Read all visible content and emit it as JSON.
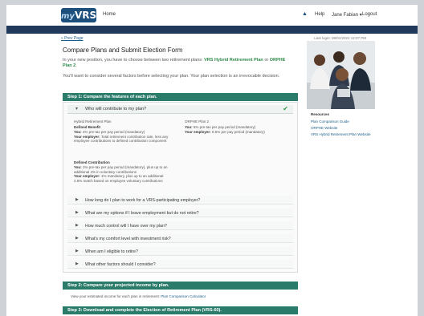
{
  "header": {
    "logo_my": "my",
    "logo_vrs": "VRS",
    "home_link": "Home",
    "help_link": "Help",
    "user_menu": "Jane Fabian ▾",
    "logout_link": "Logout"
  },
  "breadcrumb": {
    "back_link": "« Prev Page",
    "last_login": "Last login: 06/01/2021 12:07 PM"
  },
  "page": {
    "title": "Compare Plans and Submit Election Form",
    "intro_prefix": "In your new position, you have to choose between two retirement plans:",
    "intro_plan1": "VRS Hybrid Retirement Plan",
    "intro_or": "or",
    "intro_plan2": "ORPHE Plan 2",
    "intro_suffix": ".",
    "intro2": "You'll want to consider several factors before selecting your plan. Your plan selection is an irrevocable decision."
  },
  "step1": {
    "label": "Step 1: Compare the features of each plan.",
    "open_question": "Who will contribute to my plan?",
    "col1_head": "Hybrid Retirement Plan",
    "col1_sub1": "Defined Benefit",
    "col1_text1_you": "You:",
    "col1_text1": " 4% pre-tax per pay period (mandatory)",
    "col1_text1_emp": "Your employer:",
    "col1_text1b": " Total retirement contribution rate, less any employee contributions to defined contribution component",
    "col1_sub2": "Defined Contribution",
    "col1_text2_you": "You:",
    "col1_text2": " 1% pre-tax per pay period (mandatory), plus up to an additional 4% in voluntary contributions",
    "col1_text2_emp": "Your employer:",
    "col1_text2b": " 1% mandatory, plus up to an additional 2.5% match based on employee voluntary contributions",
    "col2_head": "ORPHE Plan 2",
    "col2_text_you": "You:",
    "col2_text": " 5% pre-tax per pay period (mandatory)",
    "col2_text_emp": "Your employer:",
    "col2_textb": " 8.5% per pay period (mandatory)",
    "questions": [
      "How long do I plan to work for a VRS-participating employer?",
      "What are my options if I leave employment but do not retire?",
      "How much control will I have over my plan?",
      "What's my comfort level with investment risk?",
      "When am I eligible to retire?",
      "What other factors should I consider?"
    ]
  },
  "step2": {
    "label": "Step 2: Compare your projected income by plan.",
    "text": "View your estimated income for each plan in retirement:",
    "link": "Plan Comparison Calculator"
  },
  "step3": {
    "label": "Step 3: Download and complete the Election of Retirement Plan (VRS-60)."
  },
  "resources": {
    "title": "Resources",
    "links": [
      "Plan Comparison Guide",
      "ORPHE Website",
      "VRS Hybrid Retirement Plan Website"
    ]
  },
  "colors": {
    "step_bar": "#2a7b6a",
    "nav_band": "#213a5c",
    "logo": "#1d4f7c",
    "highlight_green": "#2e8a4a"
  }
}
